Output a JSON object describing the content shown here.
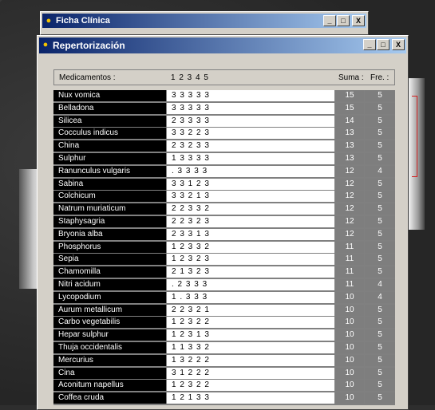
{
  "windows": {
    "ficha": {
      "title": "Ficha Clínica"
    },
    "repert": {
      "title": "Repertorización"
    }
  },
  "title_buttons": {
    "minimize": "_",
    "maximize": "□",
    "close": "X"
  },
  "table": {
    "headers": {
      "medicamentos": "Medicamentos :",
      "columns": "1 2 3 4 5",
      "suma": "Suma :",
      "fre": "Fre. :"
    },
    "rows": [
      {
        "name": "Nux vomica",
        "vals": "3 3 3 3 3",
        "suma": "15",
        "fre": "5"
      },
      {
        "name": "Belladona",
        "vals": "3 3 3 3 3",
        "suma": "15",
        "fre": "5"
      },
      {
        "name": "Silicea",
        "vals": "2 3 3 3 3",
        "suma": "14",
        "fre": "5"
      },
      {
        "name": "Cocculus indicus",
        "vals": "3 3 2 2 3",
        "suma": "13",
        "fre": "5"
      },
      {
        "name": "China",
        "vals": "2 3 2 3 3",
        "suma": "13",
        "fre": "5"
      },
      {
        "name": "Sulphur",
        "vals": "1 3 3 3 3",
        "suma": "13",
        "fre": "5"
      },
      {
        "name": "Ranunculus vulgaris",
        "vals": ". 3 3 3 3",
        "suma": "12",
        "fre": "4"
      },
      {
        "name": "Sabina",
        "vals": "3 3 1 2 3",
        "suma": "12",
        "fre": "5"
      },
      {
        "name": "Colchicum",
        "vals": "3 3 2 1 3",
        "suma": "12",
        "fre": "5"
      },
      {
        "name": "Natrum muriaticum",
        "vals": "2 2 3 3 2",
        "suma": "12",
        "fre": "5"
      },
      {
        "name": "Staphysagria",
        "vals": "2 2 3 2 3",
        "suma": "12",
        "fre": "5"
      },
      {
        "name": "Bryonia alba",
        "vals": "2 3 3 1 3",
        "suma": "12",
        "fre": "5"
      },
      {
        "name": "Phosphorus",
        "vals": "1 2 3 3 2",
        "suma": "11",
        "fre": "5"
      },
      {
        "name": "Sepia",
        "vals": "1 2 3 2 3",
        "suma": "11",
        "fre": "5"
      },
      {
        "name": "Chamomilla",
        "vals": "2 1 3 2 3",
        "suma": "11",
        "fre": "5"
      },
      {
        "name": "Nitri acidum",
        "vals": ". 2 3 3 3",
        "suma": "11",
        "fre": "4"
      },
      {
        "name": "Lycopodium",
        "vals": "1 . 3 3 3",
        "suma": "10",
        "fre": "4"
      },
      {
        "name": "Aurum metallicum",
        "vals": "2 2 3 2 1",
        "suma": "10",
        "fre": "5"
      },
      {
        "name": "Carbo vegetabilis",
        "vals": "1 2 3 2 2",
        "suma": "10",
        "fre": "5"
      },
      {
        "name": "Hepar sulphur",
        "vals": "1 2 3 1 3",
        "suma": "10",
        "fre": "5"
      },
      {
        "name": "Thuja occidentalis",
        "vals": "1 1 3 3 2",
        "suma": "10",
        "fre": "5"
      },
      {
        "name": "Mercurius",
        "vals": "1 3 2 2 2",
        "suma": "10",
        "fre": "5"
      },
      {
        "name": "Cina",
        "vals": "3 1 2 2 2",
        "suma": "10",
        "fre": "5"
      },
      {
        "name": "Aconitum napellus",
        "vals": "1 2 3 2 2",
        "suma": "10",
        "fre": "5"
      },
      {
        "name": "Coffea cruda",
        "vals": "1 2 1 3 3",
        "suma": "10",
        "fre": "5"
      }
    ]
  }
}
